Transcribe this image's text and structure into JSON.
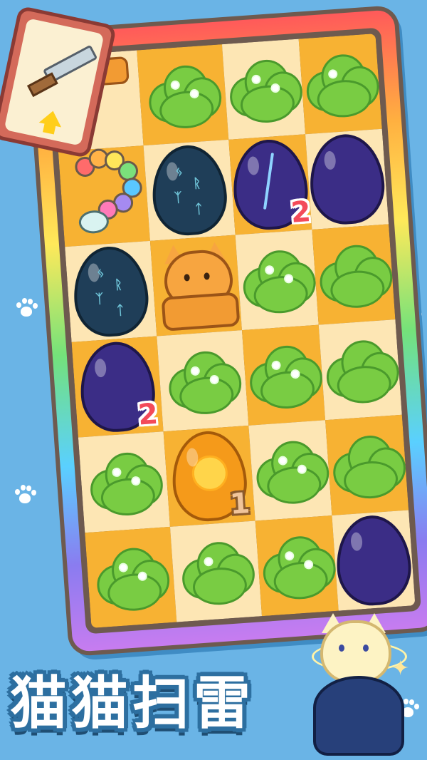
{
  "game": {
    "title": "猫猫扫雷"
  },
  "colors": {
    "background": "#6ab4e6",
    "tile_light": "#fde6b4",
    "tile_dark": "#f7b233",
    "bush": "#79cc43",
    "number": "#f34a5a"
  },
  "card": {
    "icon": "sword-icon",
    "badge_icon": "arrow-up-icon"
  },
  "board": {
    "rows": [
      [
        {
          "type": "cat-pancake-partial"
        },
        {
          "type": "bush"
        },
        {
          "type": "bush"
        },
        {
          "type": "bush"
        }
      ],
      [
        {
          "type": "snake"
        },
        {
          "type": "rune-egg"
        },
        {
          "type": "dark-egg",
          "number": "2"
        },
        {
          "type": "dark-egg"
        }
      ],
      [
        {
          "type": "rune-egg"
        },
        {
          "type": "cat"
        },
        {
          "type": "bush"
        },
        {
          "type": "bush"
        }
      ],
      [
        {
          "type": "dark-egg",
          "number": "2"
        },
        {
          "type": "bush"
        },
        {
          "type": "bush"
        },
        {
          "type": "bush"
        }
      ],
      [
        {
          "type": "bush"
        },
        {
          "type": "gold-egg",
          "number": "1"
        },
        {
          "type": "bush"
        },
        {
          "type": "bush"
        }
      ],
      [
        {
          "type": "bush"
        },
        {
          "type": "bush"
        },
        {
          "type": "bush"
        },
        {
          "type": "dark-egg"
        }
      ]
    ]
  },
  "mascot": {
    "icon": "star-wand-icon"
  }
}
